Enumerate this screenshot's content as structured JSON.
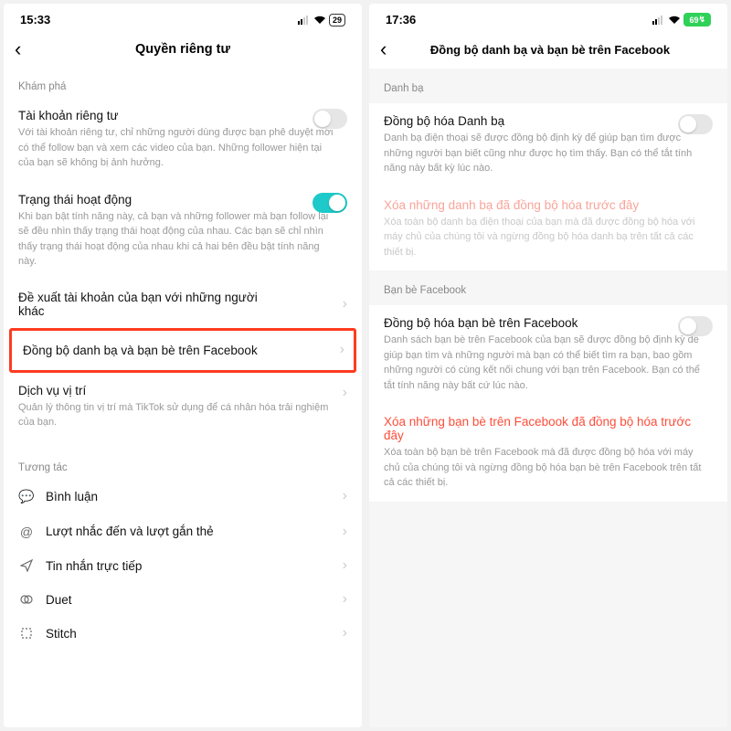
{
  "left": {
    "time": "15:33",
    "battery": "29",
    "title": "Quyền riêng tư",
    "sec1": "Khám phá",
    "r1_title": "Tài khoản riêng tư",
    "r1_desc": "Với tài khoản riêng tư, chỉ những người dùng được bạn phê duyệt mới có thể follow bạn và xem các video của bạn. Những follower hiện tại của bạn sẽ không bị ảnh hưởng.",
    "r2_title": "Trạng thái hoạt động",
    "r2_desc": "Khi bạn bật tính năng này, cả bạn và những follower mà bạn follow lại sẽ đều nhìn thấy trạng thái hoạt động của nhau. Các bạn sẽ chỉ nhìn thấy trạng thái hoạt động của nhau khi cả hai bên đều bật tính năng này.",
    "r3": "Đề xuất tài khoản của bạn với những người khác",
    "r4": "Đồng bộ danh bạ và bạn bè trên Facebook",
    "r5": "Dịch vụ vị trí",
    "r5_desc": "Quản lý thông tin vị trí mà TikTok sử dụng để cá nhân hóa trải nghiệm của bạn.",
    "sec2": "Tương tác",
    "n1": "Bình luận",
    "n2": "Lượt nhắc đến và lượt gắn thẻ",
    "n3": "Tin nhắn trực tiếp",
    "n4": "Duet",
    "n5": "Stitch"
  },
  "right": {
    "time": "17:36",
    "battery": "69",
    "title": "Đồng bộ danh bạ và bạn bè trên Facebook",
    "sec1": "Danh bạ",
    "r1_title": "Đồng bộ hóa Danh bạ",
    "r1_desc": "Danh bạ điện thoại sẽ được đồng bộ định kỳ để giúp bạn tìm được những người bạn biết cũng như được họ tìm thấy. Bạn có thể tắt tính năng này bất kỳ lúc nào.",
    "r2_title": "Xóa những danh bạ đã đồng bộ hóa trước đây",
    "r2_desc": "Xóa toàn bộ danh bạ điện thoại của bạn mà đã được đồng bộ hóa với máy chủ của chúng tôi và ngừng đồng bộ hóa danh bạ trên tất cả các thiết bị.",
    "sec2": "Bạn bè Facebook",
    "r3_title": "Đồng bộ hóa bạn bè trên Facebook",
    "r3_desc": "Danh sách bạn bè trên Facebook của bạn sẽ được đồng bộ định kỳ để giúp bạn tìm và những người mà bạn có thể biết tìm ra bạn, bao gồm những người có cùng kết nối chung với bạn trên Facebook. Bạn có thể tắt tính năng này bất cứ lúc nào.",
    "r4_title": "Xóa những bạn bè trên Facebook đã đồng bộ hóa trước đây",
    "r4_desc": "Xóa toàn bộ bạn bè trên Facebook mà đã được đồng bộ hóa với máy chủ của chúng tôi và ngừng đồng bộ hóa bạn bè trên Facebook trên tất cả các thiết bị."
  }
}
